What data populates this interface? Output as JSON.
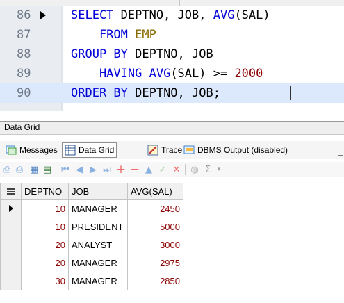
{
  "editor": {
    "lines": [
      {
        "number": "86",
        "current_marker": true,
        "tokens": [
          {
            "t": "SELECT",
            "c": "kw"
          },
          {
            "t": " DEPTNO, JOB, ",
            "c": "id"
          },
          {
            "t": "AVG",
            "c": "kw"
          },
          {
            "t": "(SAL)",
            "c": "id"
          }
        ]
      },
      {
        "number": "87",
        "tokens": [
          {
            "t": "    FROM ",
            "c": "kw"
          },
          {
            "t": "EMP",
            "c": "tbl"
          }
        ]
      },
      {
        "number": "88",
        "tokens": [
          {
            "t": "GROUP BY ",
            "c": "kw"
          },
          {
            "t": "DEPTNO, JOB",
            "c": "id"
          }
        ]
      },
      {
        "number": "89",
        "tokens": [
          {
            "t": "    HAVING ",
            "c": "kw"
          },
          {
            "t": "AVG",
            "c": "kw"
          },
          {
            "t": "(SAL) >= ",
            "c": "id"
          },
          {
            "t": "2000",
            "c": "num"
          }
        ]
      },
      {
        "number": "90",
        "highlighted": true,
        "tokens": [
          {
            "t": "ORDER BY ",
            "c": "kw"
          },
          {
            "t": "DEPTNO, JOB;",
            "c": "id"
          }
        ]
      }
    ]
  },
  "panel": {
    "title": "Data Grid"
  },
  "tabs": [
    {
      "label": "Messages",
      "icon": "messages-icon"
    },
    {
      "label": "Data Grid",
      "icon": "data-grid-icon",
      "active": true
    },
    {
      "label": "Trace",
      "icon": "trace-icon"
    },
    {
      "label": "DBMS Output (disabled)",
      "icon": "dbms-output-icon"
    }
  ],
  "toolbar": {
    "icons": [
      "print-icon",
      "print-preview-icon",
      "export-icon",
      "copy-icon",
      "first-record-icon",
      "prior-record-icon",
      "next-record-icon",
      "last-record-icon",
      "insert-record-icon",
      "delete-record-icon",
      "edit-record-icon",
      "post-record-icon",
      "cancel-record-icon",
      "refresh-icon",
      "sum-icon",
      "dropdown-icon"
    ]
  },
  "grid": {
    "columns": [
      "DEPTNO",
      "JOB",
      "AVG(SAL)"
    ],
    "rows": [
      {
        "deptno": "10",
        "job": "MANAGER",
        "avg_sal": "2450",
        "current": true
      },
      {
        "deptno": "10",
        "job": "PRESIDENT",
        "avg_sal": "5000"
      },
      {
        "deptno": "20",
        "job": "ANALYST",
        "avg_sal": "3000"
      },
      {
        "deptno": "20",
        "job": "MANAGER",
        "avg_sal": "2975"
      },
      {
        "deptno": "30",
        "job": "MANAGER",
        "avg_sal": "2850"
      }
    ]
  },
  "colors": {
    "keyword": "#0000d8",
    "table": "#8a6a00",
    "number": "#8b0000",
    "current_line": "#dce8fb"
  }
}
